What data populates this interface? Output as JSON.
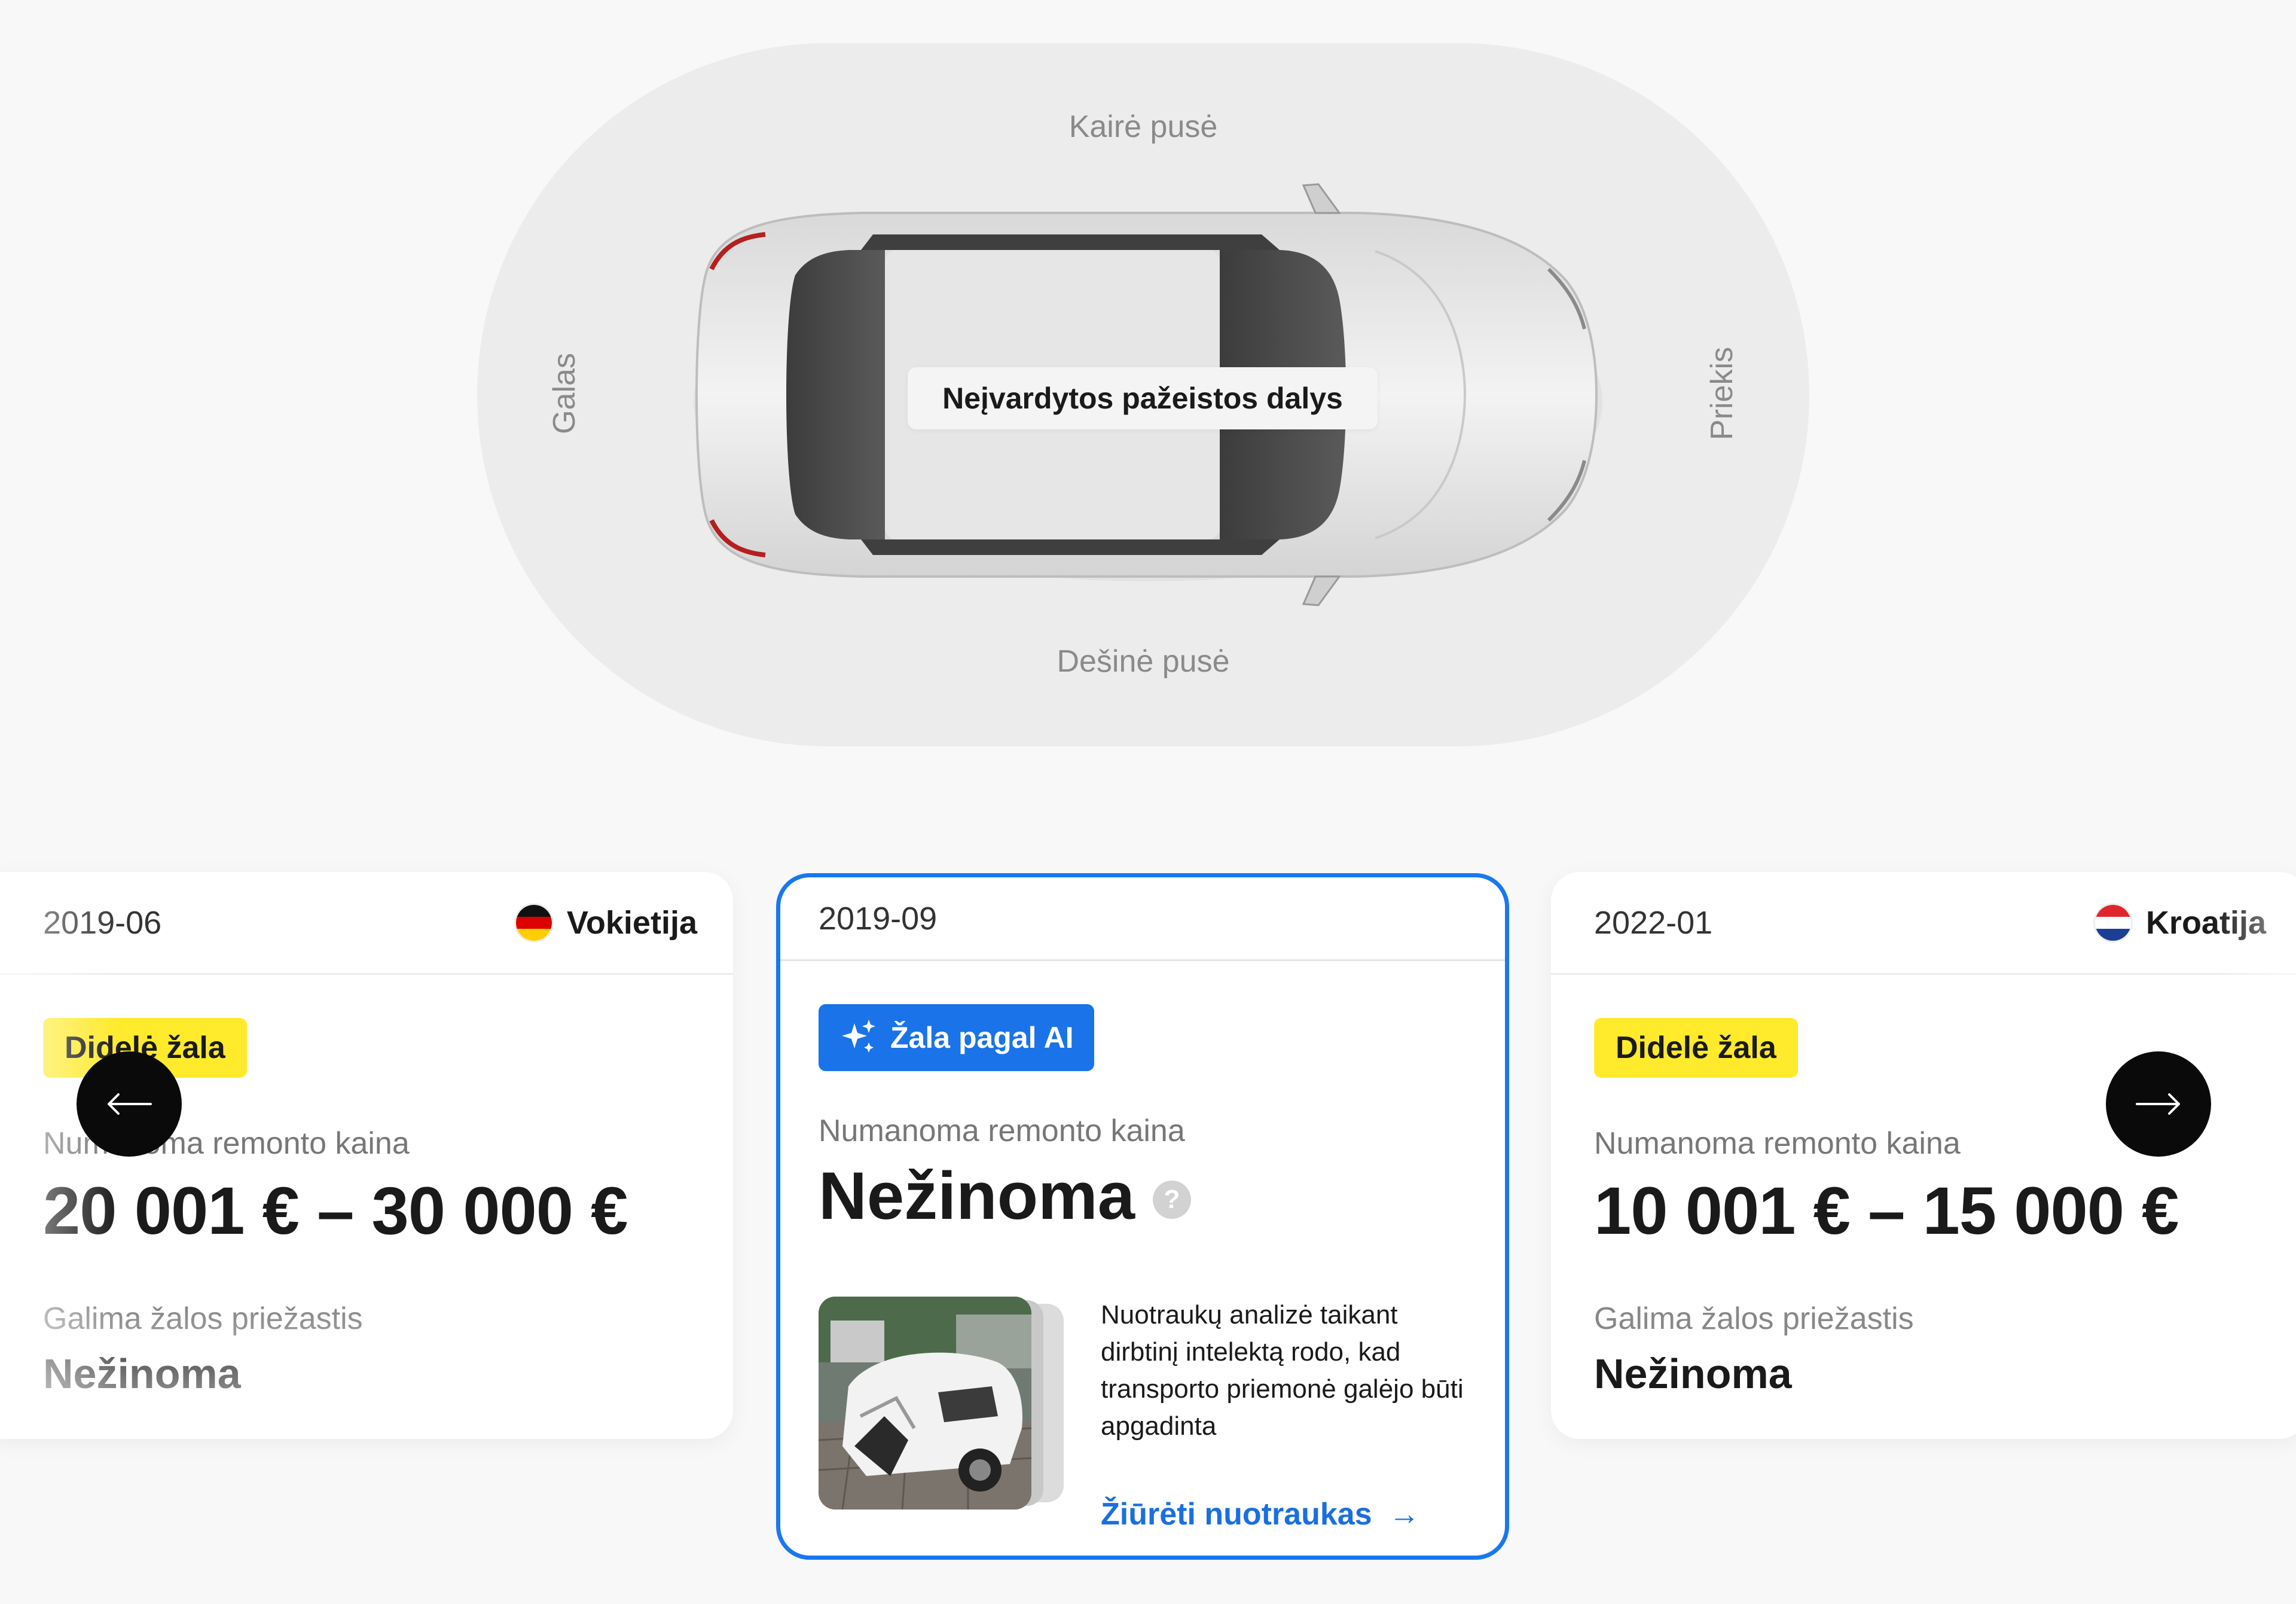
{
  "diagram": {
    "label_left_side": "Kairė pusė",
    "label_right_side": "Dešinė pusė",
    "label_rear": "Galas",
    "label_front": "Priekis",
    "damage_tag": "Neįvardytos pažeistos dalys"
  },
  "cards": [
    {
      "date": "2019-06",
      "country": "Vokietija",
      "flag": "germany-flag",
      "badge": "Didelė žala",
      "repair_label": "Numanoma remonto kaina",
      "repair_value": "20 001 € – 30 000 €",
      "cause_label": "Galima žalos priežastis",
      "cause_value": "Nežinoma"
    },
    {
      "date": "2019-09",
      "badge": "Žala pagal AI",
      "repair_label": "Numanoma remonto kaina",
      "repair_value": "Nežinoma",
      "help_icon": "?",
      "ai_description": "Nuotraukų analizė taikant dirbtinį intelektą rodo, kad transporto priemonė galėjo būti apgadinta",
      "photos_link": "Žiūrėti nuotraukas",
      "link_arrow": "→"
    },
    {
      "date": "2022-01",
      "country": "Kroatija",
      "flag": "croatia-flag",
      "badge": "Didelė žala",
      "repair_label": "Numanoma remonto kaina",
      "repair_value": "10 001 € – 15 000 €",
      "cause_label": "Galima žalos priežastis",
      "cause_value": "Nežinoma"
    }
  ],
  "navigation": {
    "prev_icon": "arrow-left-icon",
    "next_icon": "arrow-right-icon"
  },
  "colors": {
    "accent": "#1877f2",
    "badge_yellow": "#ffea2b",
    "badge_ai": "#1a73e8",
    "link": "#1a6fe0"
  }
}
